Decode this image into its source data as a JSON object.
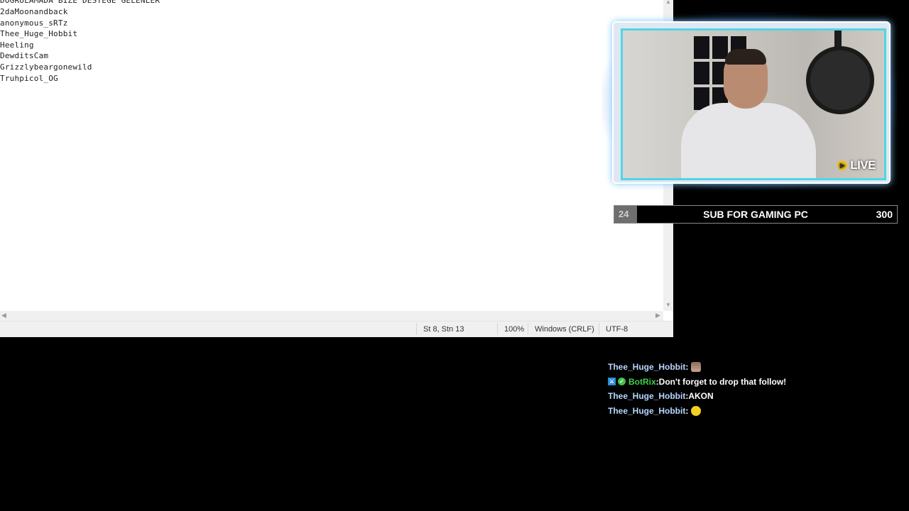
{
  "notepad": {
    "lines": [
      "DOGRULAMADA BIZE DESTEGE GELENLER",
      "2daMoonandback",
      "anonymous_sRTz",
      "Thee_Huge_Hobbit",
      "Heeling",
      "DewditsCam",
      "Grizzlybeargonewild",
      "Truhpicol_OG"
    ],
    "status": {
      "position": "St 8, Stn 13",
      "zoom": "100%",
      "line_ending": "Windows (CRLF)",
      "encoding": "UTF-8"
    }
  },
  "webcam": {
    "live_label": "LIVE",
    "frame_color": "#4fd6e6"
  },
  "goal": {
    "current": "24",
    "title": "SUB FOR GAMING PC",
    "target": "300",
    "progress_fraction": 0.08
  },
  "chat": {
    "messages": [
      {
        "user": "Thee_Huge_Hobbit",
        "separator": " :",
        "text": "",
        "emote": "face"
      },
      {
        "user": "BotRix",
        "separator": " :",
        "text": " Don't forget to drop that follow!",
        "emote": null
      },
      {
        "user": "Thee_Huge_Hobbit",
        "separator": " :",
        "text": " AKON",
        "emote": null
      },
      {
        "user": "Thee_Huge_Hobbit",
        "separator": " :",
        "text": "",
        "emote": "yellow"
      }
    ]
  }
}
